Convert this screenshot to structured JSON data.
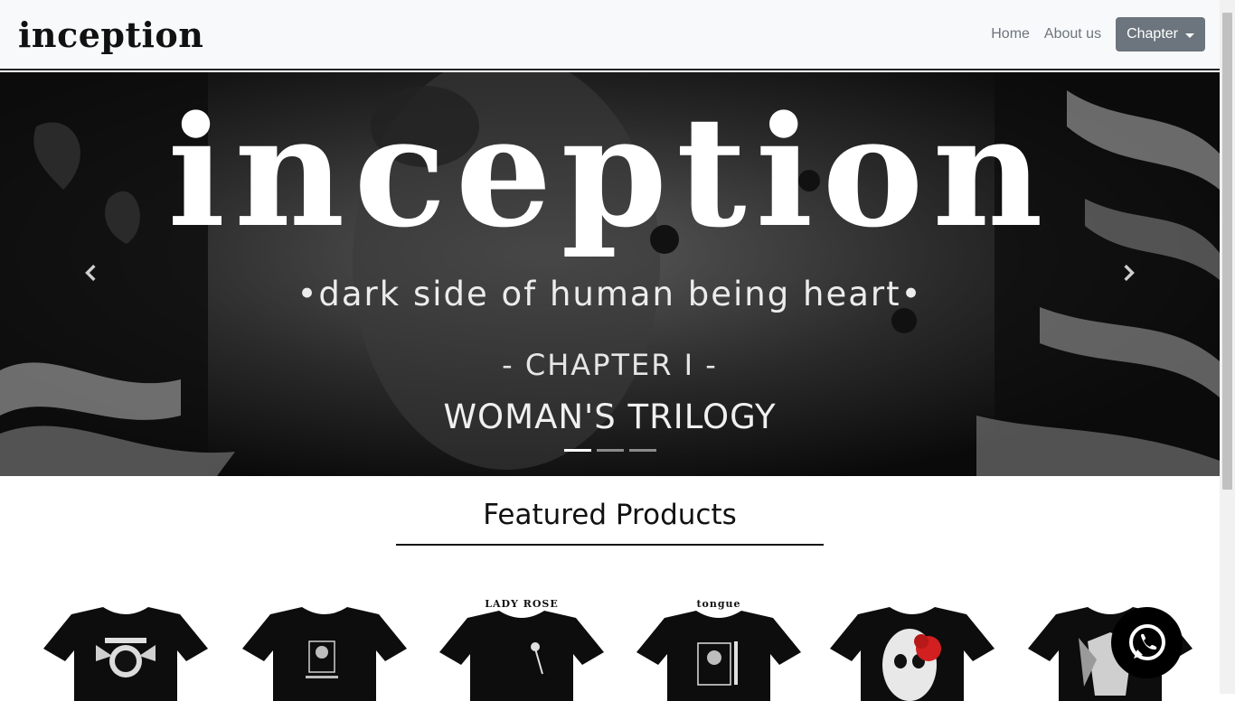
{
  "navbar": {
    "brand": "inception",
    "links": {
      "home": "Home",
      "about": "About us"
    },
    "chapter_button": "Chapter"
  },
  "carousel": {
    "title": "inception",
    "subtitle": "•dark side of human being heart•",
    "chapter": "- CHAPTER I -",
    "trilogy": "WOMAN'S TRILOGY",
    "slide_count": 3,
    "active_slide": 1
  },
  "featured": {
    "heading": "Featured Products"
  },
  "products": [
    {
      "label": ""
    },
    {
      "label": ""
    },
    {
      "label": "LADY ROSE"
    },
    {
      "label": "tongue"
    },
    {
      "label": ""
    },
    {
      "label": ""
    }
  ],
  "icons": {
    "prev": "chevron-left-icon",
    "next": "chevron-right-icon",
    "chat": "whatsapp-icon"
  },
  "colors": {
    "navbar_bg": "#f8f9fa",
    "button_bg": "#6c757d",
    "accent_red": "#d21f1f"
  }
}
